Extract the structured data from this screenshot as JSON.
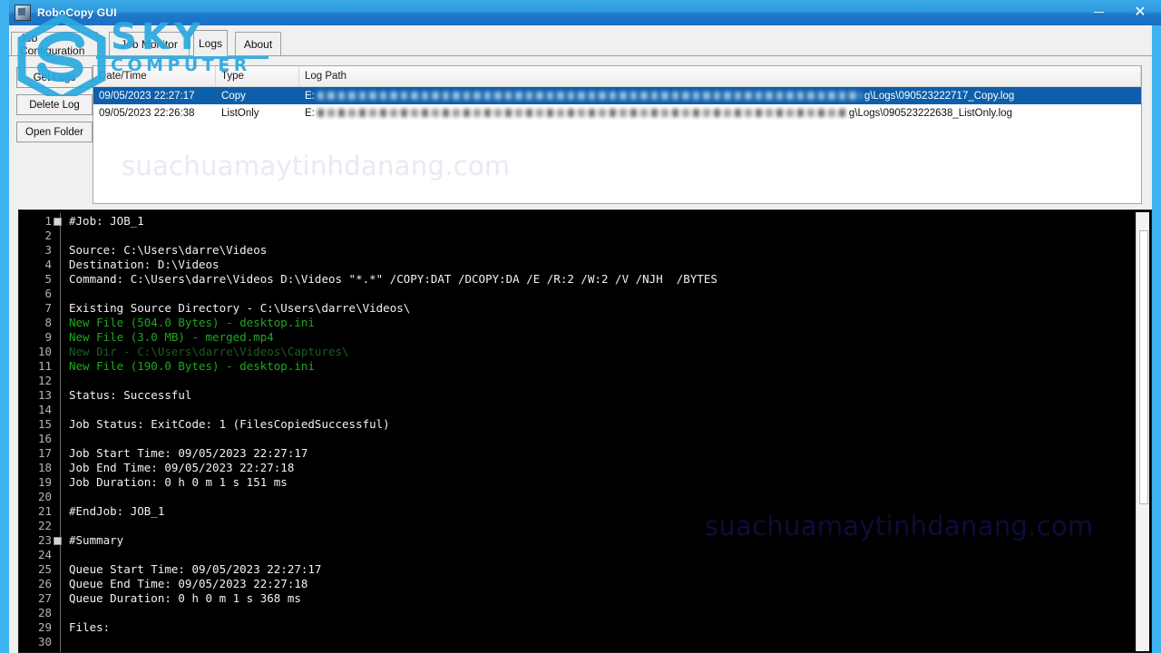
{
  "window": {
    "title": "RoboCopy GUI",
    "icon": "app-icon",
    "minimize_label": "–",
    "close_label": "✕"
  },
  "tabs": [
    {
      "label": "Job Configuration",
      "active": false
    },
    {
      "label": "Job Monitor",
      "active": false
    },
    {
      "label": "Logs",
      "active": true
    },
    {
      "label": "About",
      "active": false
    }
  ],
  "buttons": {
    "get_logs": "Get Logs",
    "delete_log": "Delete Log",
    "open_folder": "Open Folder"
  },
  "log_list": {
    "columns": [
      "Date/Time",
      "Type",
      "Log Path"
    ],
    "rows": [
      {
        "date": "09/05/2023 22:27:17",
        "type": "Copy",
        "path_prefix": "E:",
        "path_suffix": "g\\Logs\\090523222717_Copy.log",
        "selected": true
      },
      {
        "date": "09/05/2023 22:26:38",
        "type": "ListOnly",
        "path_prefix": "E:",
        "path_suffix": "g\\Logs\\090523222638_ListOnly.log",
        "selected": false
      }
    ]
  },
  "watermarks": {
    "list_area": "suachuamaytinhdanang.com",
    "console_area": "suachuamaytinhdanang.com",
    "logo_top": "SKY",
    "logo_bottom": "COMPUTER"
  },
  "console": {
    "lines": [
      {
        "n": "1",
        "fold": true,
        "text": "#Job: JOB_1",
        "color": "white"
      },
      {
        "n": "2",
        "fold": false,
        "text": "",
        "color": "white"
      },
      {
        "n": "3",
        "fold": false,
        "text": "Source: C:\\Users\\darre\\Videos",
        "color": "white"
      },
      {
        "n": "4",
        "fold": false,
        "text": "Destination: D:\\Videos",
        "color": "white"
      },
      {
        "n": "5",
        "fold": false,
        "text": "Command: C:\\Users\\darre\\Videos D:\\Videos \"*.*\" /COPY:DAT /DCOPY:DA /E /R:2 /W:2 /V /NJH  /BYTES",
        "color": "white"
      },
      {
        "n": "6",
        "fold": false,
        "text": "",
        "color": "white"
      },
      {
        "n": "7",
        "fold": false,
        "text": "Existing Source Directory - C:\\Users\\darre\\Videos\\",
        "color": "white"
      },
      {
        "n": "8",
        "fold": false,
        "text": "New File (504.0 Bytes) - desktop.ini",
        "color": "green"
      },
      {
        "n": "9",
        "fold": false,
        "text": "New File (3.0 MB) - merged.mp4",
        "color": "green"
      },
      {
        "n": "10",
        "fold": false,
        "text": "New Dir - C:\\Users\\darre\\Videos\\Captures\\",
        "color": "dim-green"
      },
      {
        "n": "11",
        "fold": false,
        "text": "New File (190.0 Bytes) - desktop.ini",
        "color": "green"
      },
      {
        "n": "12",
        "fold": false,
        "text": "",
        "color": "white"
      },
      {
        "n": "13",
        "fold": false,
        "text": "Status: Successful",
        "color": "white"
      },
      {
        "n": "14",
        "fold": false,
        "text": "",
        "color": "white"
      },
      {
        "n": "15",
        "fold": false,
        "text": "Job Status: ExitCode: 1 (FilesCopiedSuccessful)",
        "color": "white"
      },
      {
        "n": "16",
        "fold": false,
        "text": "",
        "color": "white"
      },
      {
        "n": "17",
        "fold": false,
        "text": "Job Start Time: 09/05/2023 22:27:17",
        "color": "white"
      },
      {
        "n": "18",
        "fold": false,
        "text": "Job End Time: 09/05/2023 22:27:18",
        "color": "white"
      },
      {
        "n": "19",
        "fold": false,
        "text": "Job Duration: 0 h 0 m 1 s 151 ms",
        "color": "white"
      },
      {
        "n": "20",
        "fold": false,
        "text": "",
        "color": "white"
      },
      {
        "n": "21",
        "fold": false,
        "text": "#EndJob: JOB_1",
        "color": "white"
      },
      {
        "n": "22",
        "fold": false,
        "text": "",
        "color": "white"
      },
      {
        "n": "23",
        "fold": true,
        "text": "#Summary",
        "color": "white"
      },
      {
        "n": "24",
        "fold": false,
        "text": "",
        "color": "white"
      },
      {
        "n": "25",
        "fold": false,
        "text": "Queue Start Time: 09/05/2023 22:27:17",
        "color": "white"
      },
      {
        "n": "26",
        "fold": false,
        "text": "Queue End Time: 09/05/2023 22:27:18",
        "color": "white"
      },
      {
        "n": "27",
        "fold": false,
        "text": "Queue Duration: 0 h 0 m 1 s 368 ms",
        "color": "white"
      },
      {
        "n": "28",
        "fold": false,
        "text": "",
        "color": "white"
      },
      {
        "n": "29",
        "fold": false,
        "text": "Files:",
        "color": "white"
      },
      {
        "n": "30",
        "fold": false,
        "text": "",
        "color": "white"
      }
    ]
  },
  "colors": {
    "titlebar_blue": "#1b6fc4",
    "frame_blue": "#3fb3f0",
    "selection_blue": "#0d5fab",
    "console_bg": "#000000",
    "new_file_green": "#1fa81f",
    "new_dir_green": "#1b5e20",
    "logo_cyan": "#2aa9e0"
  }
}
